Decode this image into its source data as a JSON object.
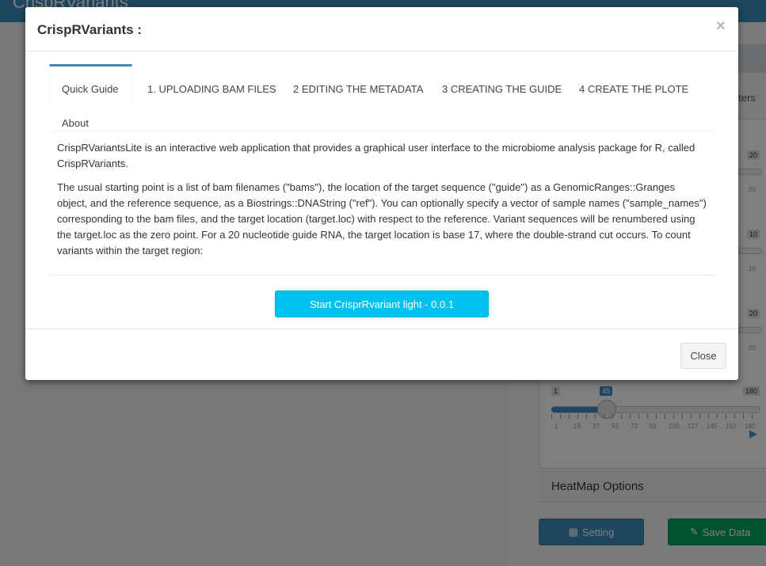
{
  "app": {
    "title": "CrispRVariants",
    "right_panel": {
      "partial_label": "eters",
      "slider_badges": [
        "20",
        "10",
        "20"
      ],
      "slider_small": [
        "20",
        "10",
        "20"
      ],
      "animated_slider": {
        "min": "1",
        "value": "45",
        "max": "180",
        "fraction": 0.25,
        "ticks": [
          "1",
          "19",
          "37",
          "55",
          "73",
          "91",
          "109",
          "127",
          "145",
          "163",
          "180"
        ]
      },
      "heatmap_label": "HeatMap Options",
      "setting_button": "Setting",
      "save_button": "Save Data"
    }
  },
  "modal": {
    "title": "CrispRVariants :",
    "close_x": "×",
    "tabs": [
      {
        "label": "Quick Guide",
        "active": true
      },
      {
        "label": "1. UPLOADING BAM FILES",
        "active": false
      },
      {
        "label": "2 EDITING THE METADATA",
        "active": false
      },
      {
        "label": "3 CREATING THE GUIDE",
        "active": false
      },
      {
        "label": "4 CREATE THE PLOTE",
        "active": false
      },
      {
        "label": "About",
        "active": false
      }
    ],
    "paragraphs": [
      "CrispRVariantsLite is an interactive web application that provides a graphical user interface to the microbiome analysis package for R, called CrispRVariants.",
      "The usual starting point is a list of bam filenames (\"bams\"), the location of the target sequence (\"guide\") as a GenomicRanges::Granges object, and the reference sequence, as a Biostrings::DNAString (\"ref\"). You can optionally specify a vector of sample names (\"sample_names\") corresponding to the bam files, and the target location (target.loc) with respect to the reference. Variant sequences will be renumbered using the target.loc as the zero point. For a 20 nucleotide guide RNA, the target location is base 17, where the double-strand cut occurs. To count variants within the target region:"
    ],
    "start_button": "Start CrisprRvariant light - 0.0.1",
    "close_button": "Close"
  },
  "colors": {
    "header": "#3c8dbc",
    "start_button": "#00c0ef",
    "tab_active_border": "#3c8dbc",
    "setting_button": "#3c8dbc",
    "save_button": "#00a65a"
  }
}
